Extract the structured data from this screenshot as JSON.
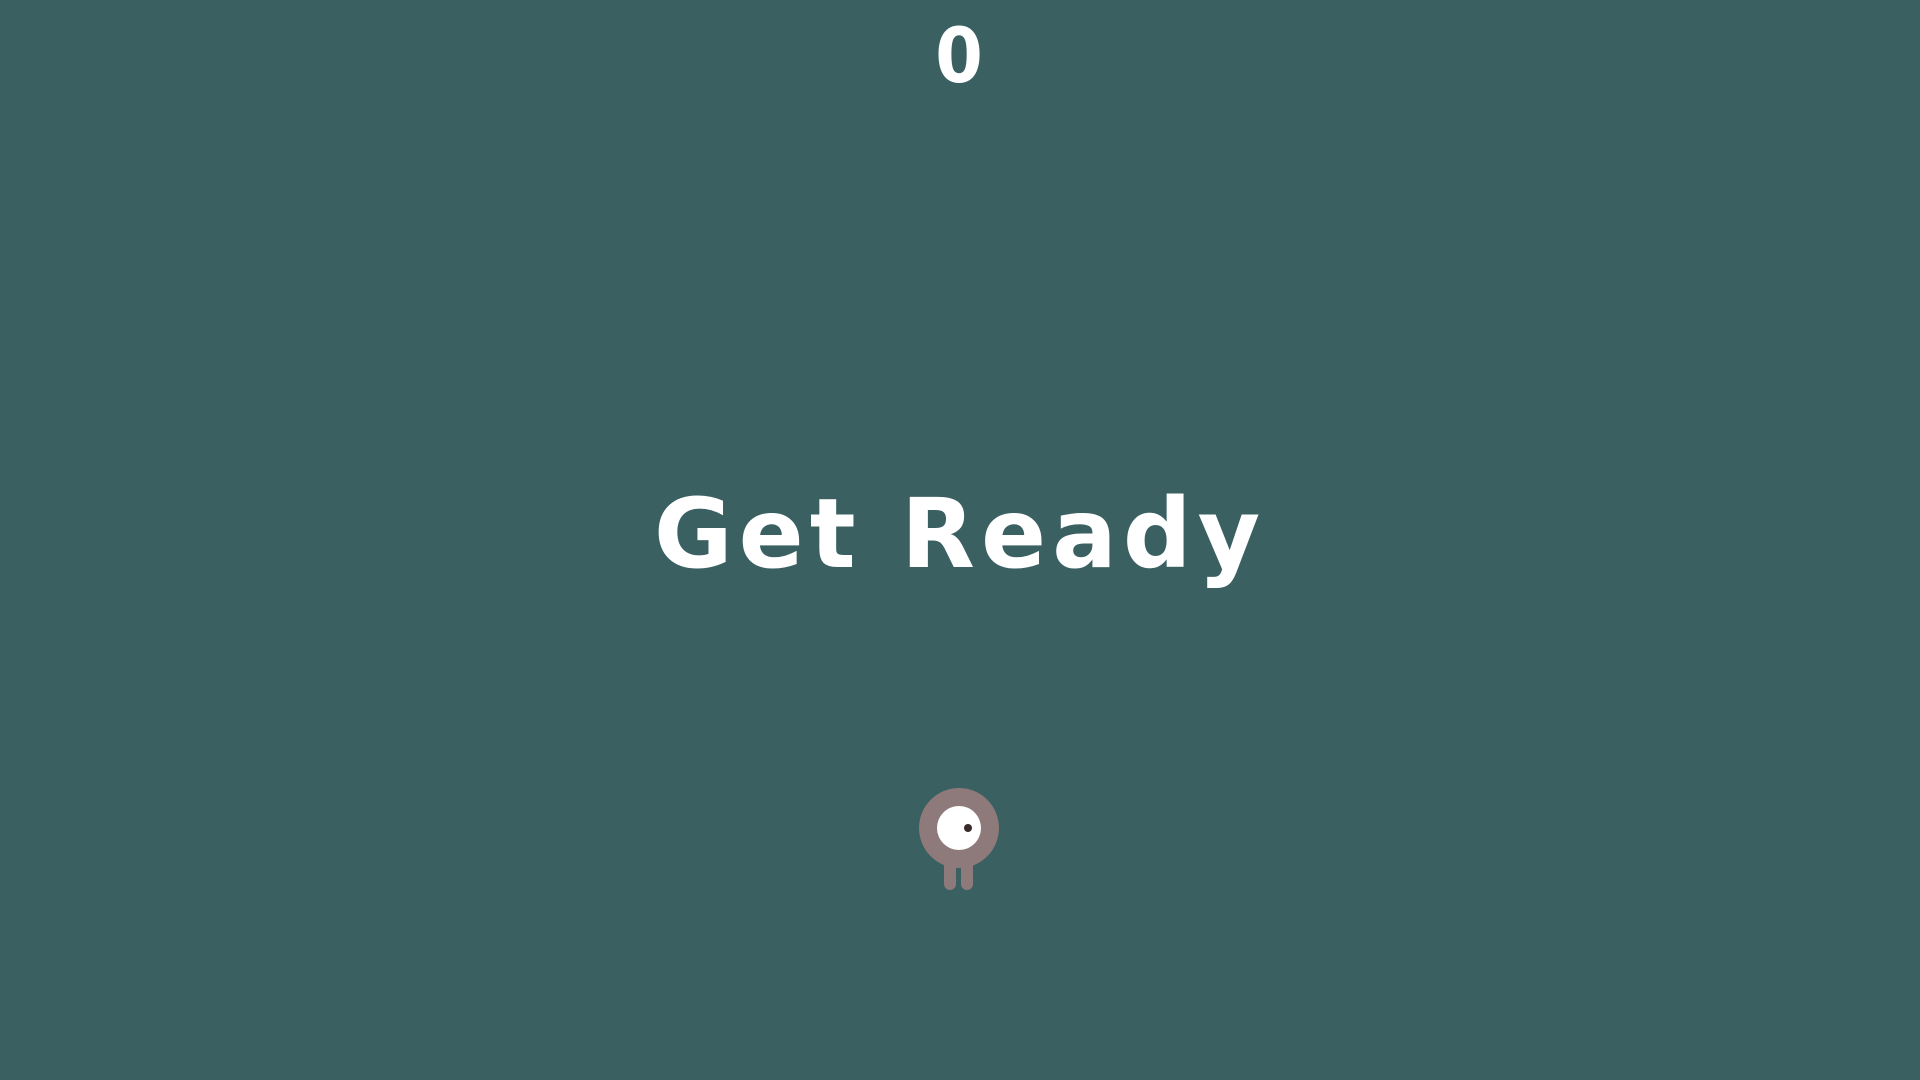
{
  "hud": {
    "score": "0"
  },
  "overlay": {
    "message": "Get Ready"
  },
  "player": {
    "icon": "one-eyed-creature-icon"
  },
  "colors": {
    "background": "#3a6062",
    "text": "#ffffff",
    "creature_body": "#8e7a7a",
    "creature_eye": "#ffffff",
    "creature_pupil": "#3a2a2a"
  }
}
